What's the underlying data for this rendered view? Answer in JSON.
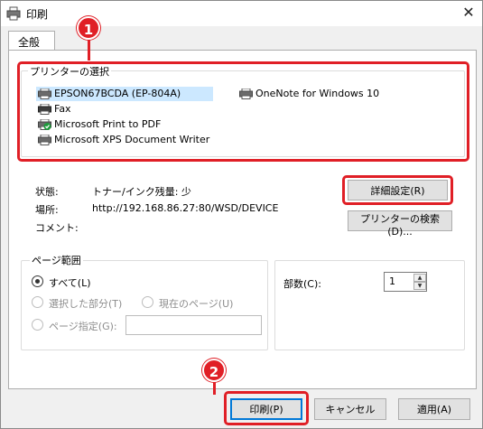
{
  "window": {
    "title": "印刷"
  },
  "tab": {
    "label": "全般"
  },
  "printer_group": {
    "label": "プリンターの選択",
    "printers": [
      {
        "name": "EPSON67BCDA (EP-804A)",
        "icon": "printer-icon",
        "selected": true
      },
      {
        "name": "OneNote for Windows 10",
        "icon": "printer-icon"
      },
      {
        "name": "Fax",
        "icon": "fax-printer-icon"
      },
      {
        "name": "Microsoft Print to PDF",
        "icon": "default-printer-icon"
      },
      {
        "name": "Microsoft XPS Document Writer",
        "icon": "printer-icon"
      }
    ]
  },
  "status": {
    "status_label": "状態:",
    "status_value": "トナー/インク残量: 少",
    "location_label": "場所:",
    "location_value": "http://192.168.86.27:80/WSD/DEVICE",
    "comment_label": "コメント:",
    "comment_value": ""
  },
  "buttons": {
    "preferences": "詳細設定(R)",
    "find_printer": "プリンターの検索(D)...",
    "print": "印刷(P)",
    "cancel": "キャンセル",
    "apply": "適用(A)"
  },
  "page_range": {
    "label": "ページ範囲",
    "all": "すべて(L)",
    "selection": "選択した部分(T)",
    "current_page": "現在のページ(U)",
    "pages": "ページ指定(G):",
    "pages_value": ""
  },
  "copies": {
    "label": "部数(C):",
    "value": "1"
  },
  "annotations": {
    "badge1": "1",
    "badge2": "2",
    "highlight_color": "#e01f26"
  },
  "colors": {
    "selected_item": "#cce8ff",
    "default_button_border": "#0078d7"
  }
}
